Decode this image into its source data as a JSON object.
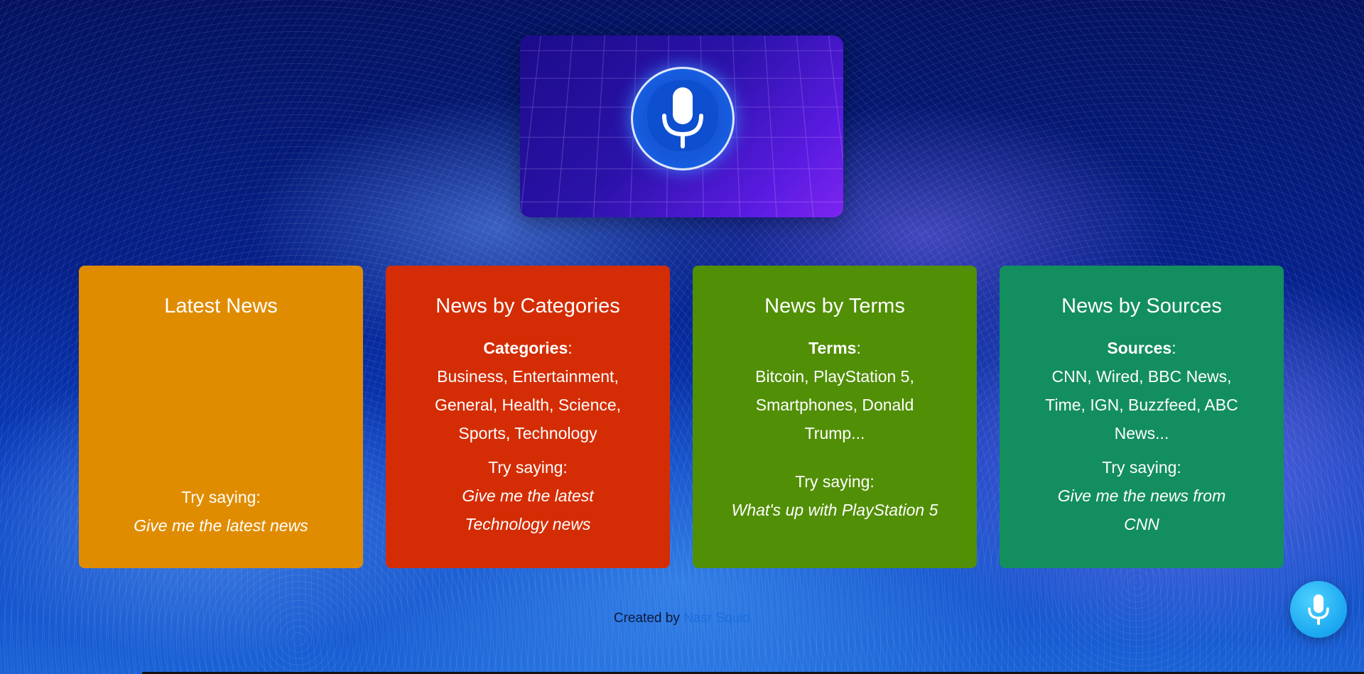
{
  "hero": {
    "icon": "microphone-icon"
  },
  "cards": [
    {
      "title": "Latest News",
      "try_label": "Try saying:",
      "example": "Give me the latest news",
      "color": "#e08c00"
    },
    {
      "title": "News by Categories",
      "list_label": "Categories",
      "list_colon": ":",
      "list_lines": [
        "Business, Entertainment,",
        "General, Health, Science,",
        "Sports, Technology"
      ],
      "try_label": "Try saying:",
      "example_lines": [
        "Give me the latest",
        "Technology news"
      ],
      "color": "#d42d05"
    },
    {
      "title": "News by Terms",
      "list_label": "Terms",
      "list_colon": ":",
      "list_lines": [
        "Bitcoin, PlayStation 5,",
        "Smartphones, Donald",
        "Trump..."
      ],
      "try_label": "Try saying:",
      "example": "What's up with PlayStation 5",
      "color": "#518f06"
    },
    {
      "title": "News by Sources",
      "list_label": "Sources",
      "list_colon": ":",
      "list_lines": [
        "CNN, Wired, BBC News,",
        "Time, IGN, Buzzfeed, ABC",
        "News..."
      ],
      "try_label": "Try saying:",
      "example_lines": [
        "Give me the news from",
        "CNN"
      ],
      "color": "#138e5f"
    }
  ],
  "footer": {
    "prefix": "Created by",
    "author": "Nasr Squid"
  },
  "fab": {
    "icon": "microphone-icon"
  }
}
